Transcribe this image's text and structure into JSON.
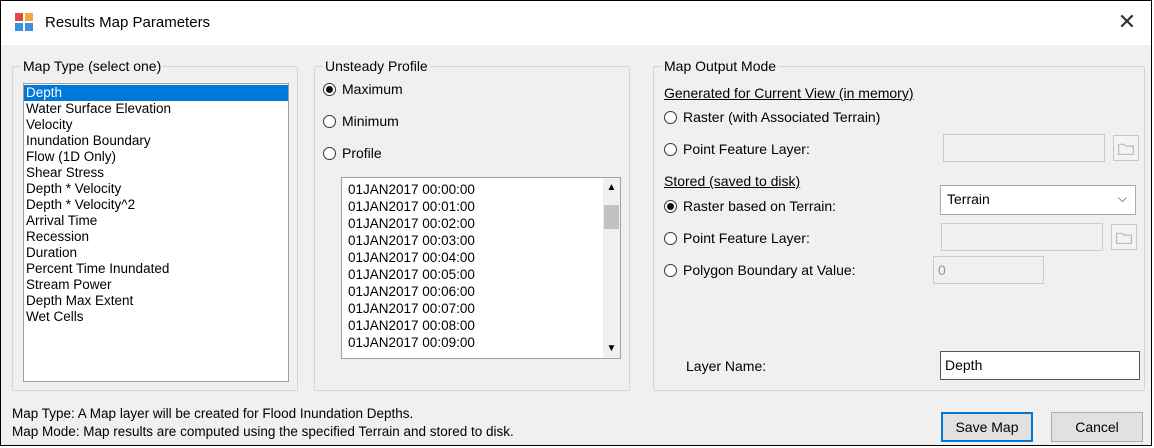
{
  "window": {
    "title": "Results Map Parameters",
    "close_symbol": "✕"
  },
  "map_type": {
    "group_title": "Map Type (select one)",
    "items": [
      "Depth",
      "Water Surface Elevation",
      "Velocity",
      "Inundation Boundary",
      "Flow (1D Only)",
      "Shear Stress",
      "Depth * Velocity",
      "Depth * Velocity^2",
      "Arrival Time",
      "Recession",
      "Duration",
      "Percent Time Inundated",
      "Stream Power",
      "Depth Max Extent",
      "Wet Cells"
    ],
    "selected": "Depth"
  },
  "unsteady_profile": {
    "group_title": "Unsteady Profile",
    "options": [
      "Maximum",
      "Minimum",
      "Profile"
    ],
    "selected": "Maximum",
    "times": [
      "01JAN2017 00:00:00",
      "01JAN2017 00:01:00",
      "01JAN2017 00:02:00",
      "01JAN2017 00:03:00",
      "01JAN2017 00:04:00",
      "01JAN2017 00:05:00",
      "01JAN2017 00:06:00",
      "01JAN2017 00:07:00",
      "01JAN2017 00:08:00",
      "01JAN2017 00:09:00"
    ]
  },
  "output_mode": {
    "group_title": "Map Output Mode",
    "current_view_heading": "Generated for Current View (in memory)",
    "raster_assoc_label": "Raster (with Associated Terrain)",
    "point_feature_label": "Point Feature Layer:",
    "stored_heading": "Stored (saved to disk)",
    "raster_terrain_label": "Raster based on Terrain:",
    "terrain_value": "Terrain",
    "polygon_boundary_label": "Polygon Boundary at Value:",
    "polygon_value": "0",
    "selected": "Raster based on Terrain:",
    "layer_name_label": "Layer Name:",
    "layer_name_value": "Depth"
  },
  "info": {
    "map_type_text": "Map Type: A Map layer will be created for Flood Inundation Depths.",
    "map_mode_text": "Map Mode: Map results are computed using the specified Terrain and stored to disk."
  },
  "buttons": {
    "save": "Save Map",
    "cancel": "Cancel"
  }
}
